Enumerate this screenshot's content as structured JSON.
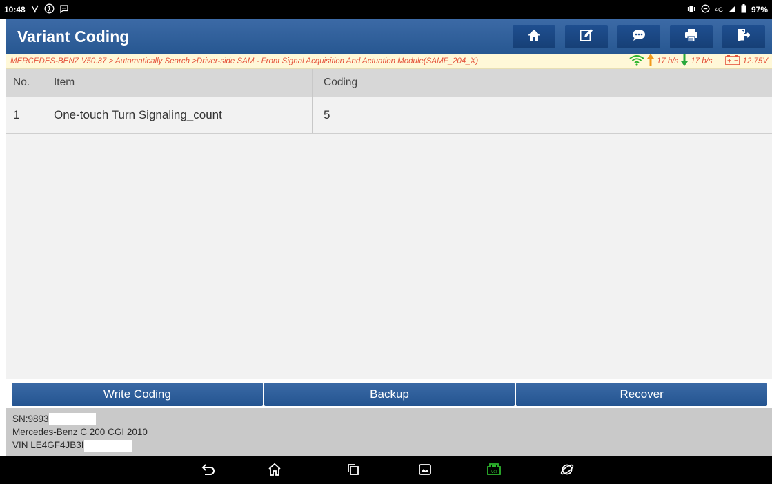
{
  "status_bar": {
    "time": "10:48",
    "network": "4G",
    "battery": "97%"
  },
  "header": {
    "title": "Variant Coding",
    "toolbar_icons": [
      "home-icon",
      "edit-icon",
      "chat-icon",
      "print-icon",
      "exit-icon"
    ]
  },
  "breadcrumb": {
    "text": "MERCEDES-BENZ V50.37 > Automatically Search >Driver-side SAM - Front Signal Acquisition And Actuation Module(SAMF_204_X)",
    "upload_rate": "17 b/s",
    "download_rate": "17 b/s",
    "voltage": "12.75V"
  },
  "table": {
    "headers": {
      "no": "No.",
      "item": "Item",
      "coding": "Coding"
    },
    "rows": [
      {
        "no": "1",
        "item": "One-touch Turn Signaling_count",
        "coding": "5"
      }
    ]
  },
  "actions": {
    "write": "Write Coding",
    "backup": "Backup",
    "recover": "Recover"
  },
  "footer": {
    "sn": "SN:9893",
    "vehicle": "Mercedes-Benz C 200 CGI 2010",
    "vin": "VIN LE4GF4JB3I"
  },
  "colors": {
    "header_blue": "#2f5f9c",
    "breadcrumb_text": "#e5533b",
    "wifi_green": "#2db52d",
    "upload_orange": "#f29a1b",
    "download_green": "#2aa83a"
  }
}
